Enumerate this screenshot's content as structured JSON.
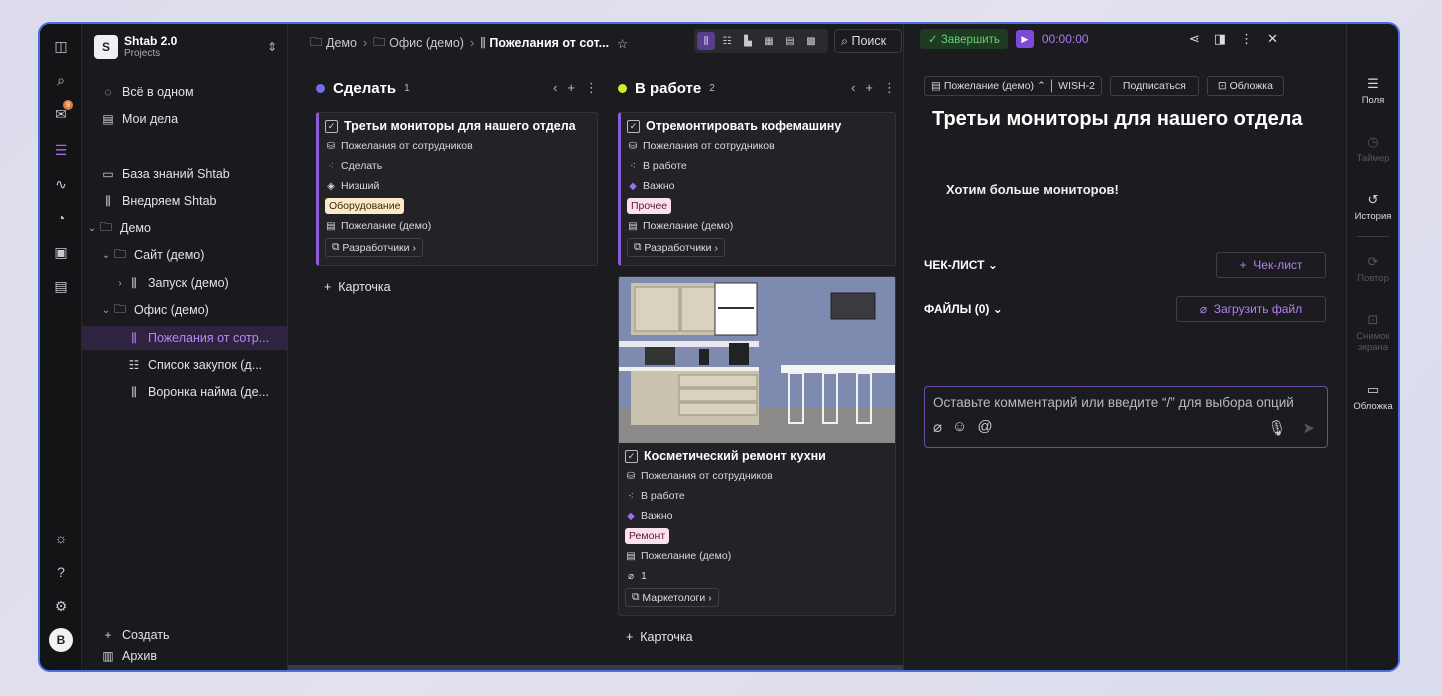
{
  "workspace": {
    "logo": "S",
    "title": "Shtab 2.0",
    "subtitle": "Projects"
  },
  "rail": {
    "inbox_badge": "9",
    "avatar": "B"
  },
  "sidebar": {
    "all_in_one": "Всё в одном",
    "my_tasks": "Мои дела",
    "items": [
      {
        "label": "База знаний Shtab"
      },
      {
        "label": "Внедряем Shtab"
      },
      {
        "label": "Демо"
      },
      {
        "label": "Сайт (демо)"
      },
      {
        "label": "Запуск (демо)"
      },
      {
        "label": "Офис (демо)"
      },
      {
        "label": "Пожелания от сотр..."
      },
      {
        "label": "Список закупок (д..."
      },
      {
        "label": "Воронка найма (де..."
      }
    ],
    "create": "Создать",
    "archive": "Архив"
  },
  "breadcrumb": {
    "demo": "Демо",
    "office": "Офис (демо)",
    "current": "Пожелания от сот..."
  },
  "search": {
    "label": "Поиск"
  },
  "columns": [
    {
      "title": "Сделать",
      "count": "1",
      "dot_color": "#6f6fe6",
      "cards": [
        {
          "title": "Третьи мониторы для нашего отдела",
          "source": "Пожелания от сотрудников",
          "status": "Сделать",
          "priority": "Низший",
          "tag": "Оборудование",
          "type": "Пожелание (демо)",
          "team": "Разработчики"
        }
      ],
      "add_label": "Карточка"
    },
    {
      "title": "В работе",
      "count": "2",
      "dot_color": "#d6e830",
      "cards": [
        {
          "title": "Отремонтировать кофемашину",
          "source": "Пожелания от сотрудников",
          "status": "В работе",
          "priority": "Важно",
          "tag": "Прочее",
          "type": "Пожелание (демо)",
          "team": "Разработчики"
        },
        {
          "title": "Косметический ремонт кухни",
          "source": "Пожелания от сотрудников",
          "status": "В работе",
          "priority": "Важно",
          "tag": "Ремонт",
          "type": "Пожелание (демо)",
          "attachments": "1",
          "team": "Маркетологи"
        }
      ],
      "add_label": "Карточка"
    }
  ],
  "detail": {
    "finish": "Завершить",
    "timer": "00:00:00",
    "type_chip": "Пожелание (демо)",
    "id_chip": "WISH-2",
    "subscribe": "Подписаться",
    "cover": "Обложка",
    "title": "Третьи мониторы для нашего отдела",
    "description": "Хотим больше мониторов!",
    "checklist": "ЧЕК-ЛИСТ",
    "add_checklist": "Чек-лист",
    "files": "ФАЙЛЫ (0)",
    "upload": "Загрузить файл",
    "comment_placeholder": "Оставьте комментарий или введите “/” для выбора опций"
  },
  "right_panel": {
    "fields": "Поля",
    "timer": "Таймер",
    "history": "История",
    "repeat": "Повтор",
    "screenshot": "Снимок экрана",
    "cover": "Обложка"
  }
}
